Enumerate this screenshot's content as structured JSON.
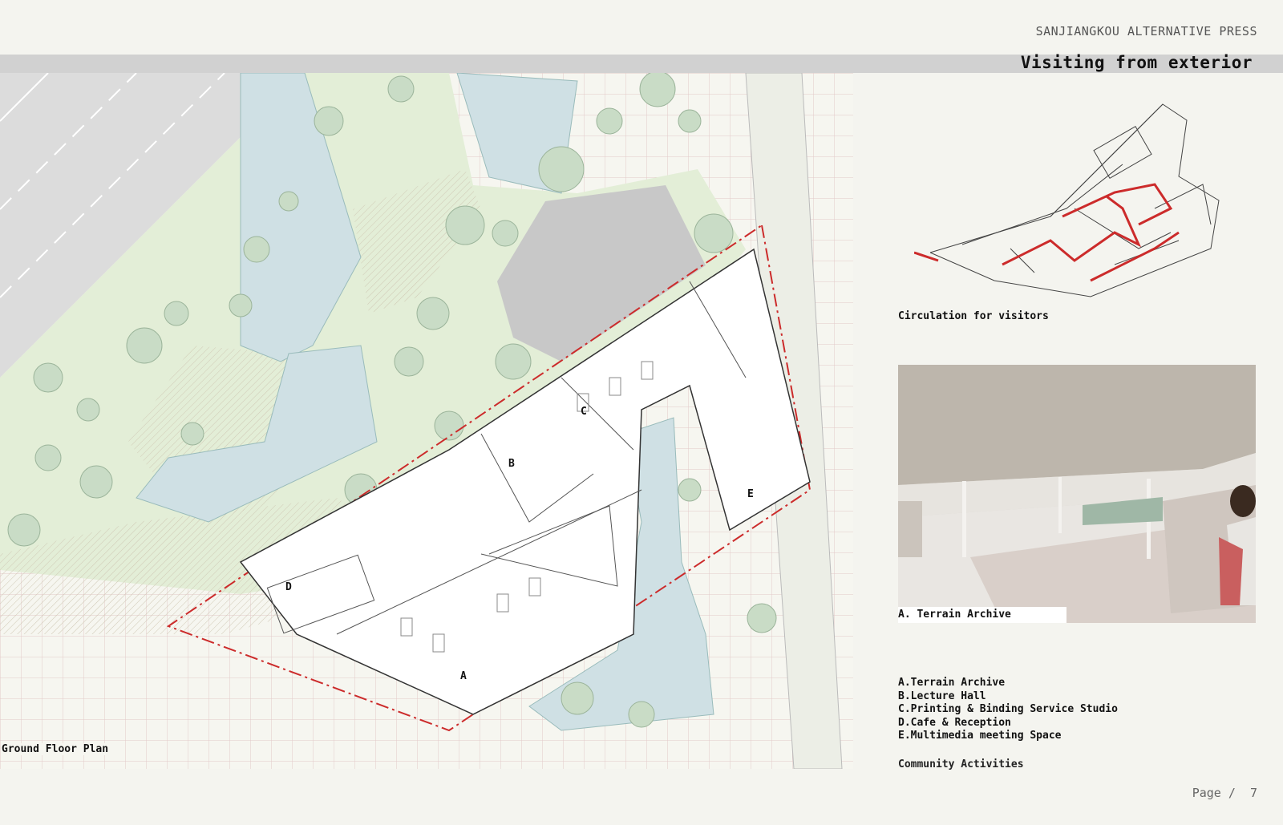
{
  "header": {
    "publisher": "SANJIANGKOU ALTERNATIVE PRESS",
    "title": "Visiting from exterior"
  },
  "plan": {
    "caption": "Ground Floor Plan",
    "zones": [
      "A",
      "B",
      "C",
      "D",
      "E"
    ]
  },
  "circulation": {
    "caption": "Circulation for visitors"
  },
  "render": {
    "caption": "A. Terrain Archive"
  },
  "legend": {
    "items": [
      "A.Terrain Archive",
      "B.Lecture Hall",
      "C.Printing & Binding Service Studio",
      "D.Cafe & Reception",
      "E.Multimedia meeting Space"
    ]
  },
  "community": "Community Activities",
  "footer": {
    "page_label": "Page /",
    "page_number": "7"
  },
  "colors": {
    "accent_red": "#cc2b2b",
    "water": "#cfe0e4",
    "lawn": "#e3eed7",
    "building": "#ffffff",
    "title_bar": "#d1d1d1"
  }
}
